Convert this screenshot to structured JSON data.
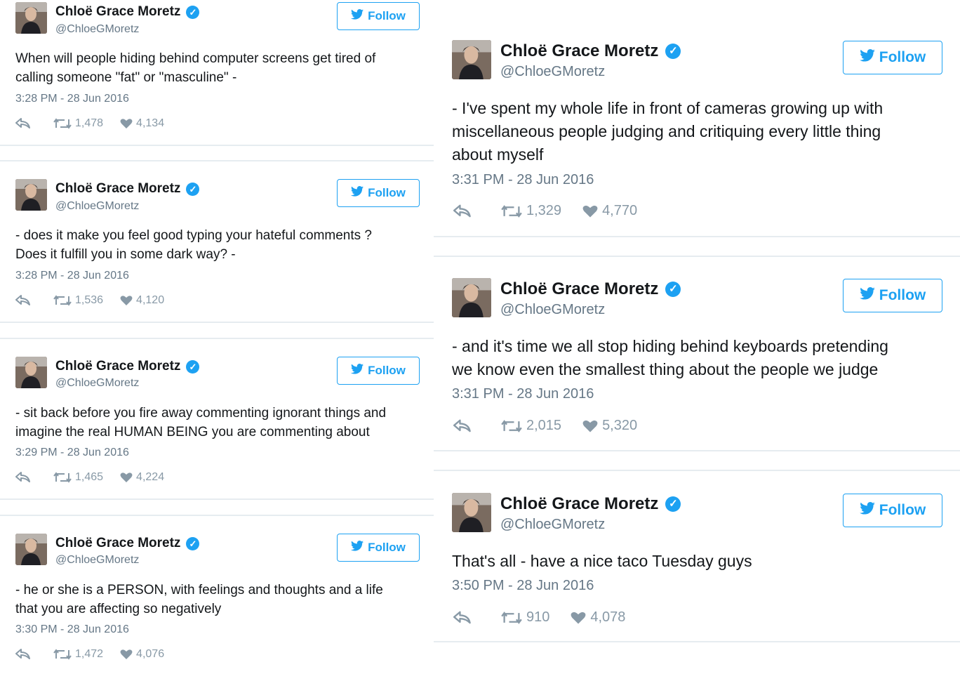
{
  "colors": {
    "accent": "#1da1f2",
    "name": "#14171a",
    "meta": "#657786",
    "icons": "#8899a6",
    "divider": "#e6ecf0"
  },
  "icons": {
    "verified": "verified-badge-icon",
    "follow_bird": "twitter-bird-icon",
    "reply": "reply-icon",
    "retweet": "retweet-icon",
    "like": "heart-icon"
  },
  "tweets": [
    {
      "name": "Chloë Grace Moretz",
      "handle": "@ChloeGMoretz",
      "follow_label": "Follow",
      "text_lines": [
        "When will people hiding behind computer screens get tired of",
        "calling someone \"fat\" or \"masculine\" -"
      ],
      "time": "3:28 PM - 28 Jun 2016",
      "retweets": "1,478",
      "likes": "4,134"
    },
    {
      "name": "Chloë Grace Moretz",
      "handle": "@ChloeGMoretz",
      "follow_label": "Follow",
      "text_lines": [
        "- does it make you feel good typing your hateful comments ?",
        "Does it fulfill you in some dark way? -"
      ],
      "time": "3:28 PM - 28 Jun 2016",
      "retweets": "1,536",
      "likes": "4,120"
    },
    {
      "name": "Chloë Grace Moretz",
      "handle": "@ChloeGMoretz",
      "follow_label": "Follow",
      "text_lines": [
        "- sit back before you fire away commenting ignorant things and",
        "imagine the real HUMAN BEING you are commenting about"
      ],
      "time": "3:29 PM - 28 Jun 2016",
      "retweets": "1,465",
      "likes": "4,224"
    },
    {
      "name": "Chloë Grace Moretz",
      "handle": "@ChloeGMoretz",
      "follow_label": "Follow",
      "text_lines": [
        "- he or she is a PERSON, with feelings and thoughts and a life",
        "that you are affecting so negatively"
      ],
      "time": "3:30 PM - 28 Jun 2016",
      "retweets": "1,472",
      "likes": "4,076"
    },
    {
      "name": "Chloë Grace Moretz",
      "handle": "@ChloeGMoretz",
      "follow_label": "Follow",
      "text_lines": [
        "- I've spent my whole life in front of cameras growing up with",
        "miscellaneous people judging and critiquing every little thing",
        "about myself"
      ],
      "time": "3:31 PM - 28 Jun 2016",
      "retweets": "1,329",
      "likes": "4,770"
    },
    {
      "name": "Chloë Grace Moretz",
      "handle": "@ChloeGMoretz",
      "follow_label": "Follow",
      "text_lines": [
        "- and it's time we all stop hiding behind keyboards pretending",
        "we know even the smallest thing about the people we judge"
      ],
      "time": "3:31 PM - 28 Jun 2016",
      "retweets": "2,015",
      "likes": "5,320"
    },
    {
      "name": "Chloë Grace Moretz",
      "handle": "@ChloeGMoretz",
      "follow_label": "Follow",
      "text_lines": [
        "That's all - have a nice taco Tuesday guys"
      ],
      "time": "3:50 PM - 28 Jun 2016",
      "retweets": "910",
      "likes": "4,078"
    }
  ]
}
